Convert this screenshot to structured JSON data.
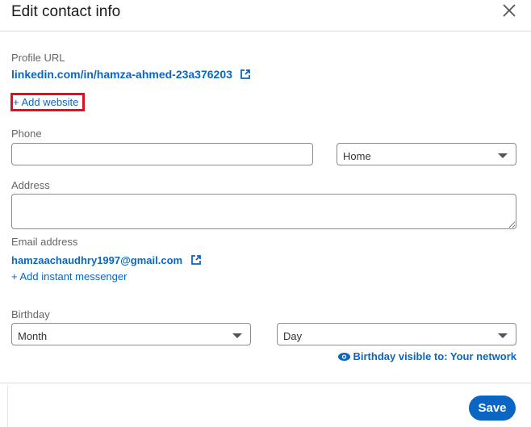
{
  "header": {
    "title": "Edit contact info",
    "close_icon": "close-icon"
  },
  "profile": {
    "label": "Profile URL",
    "url": "linkedin.com/in/hamza-ahmed-23a376203",
    "add_website": "+ Add website"
  },
  "phone": {
    "label": "Phone",
    "value": "",
    "type_selected": "Home"
  },
  "address": {
    "label": "Address",
    "value": ""
  },
  "email": {
    "label": "Email address",
    "value": "hamzaachaudhry1997@gmail.com",
    "add_messenger": "+ Add instant messenger"
  },
  "birthday": {
    "label": "Birthday",
    "month_selected": "Month",
    "day_selected": "Day",
    "visibility": "Birthday visible to: Your network"
  },
  "footer": {
    "save_label": "Save"
  },
  "colors": {
    "accent": "#0a66c2",
    "highlight": "#e01020"
  }
}
